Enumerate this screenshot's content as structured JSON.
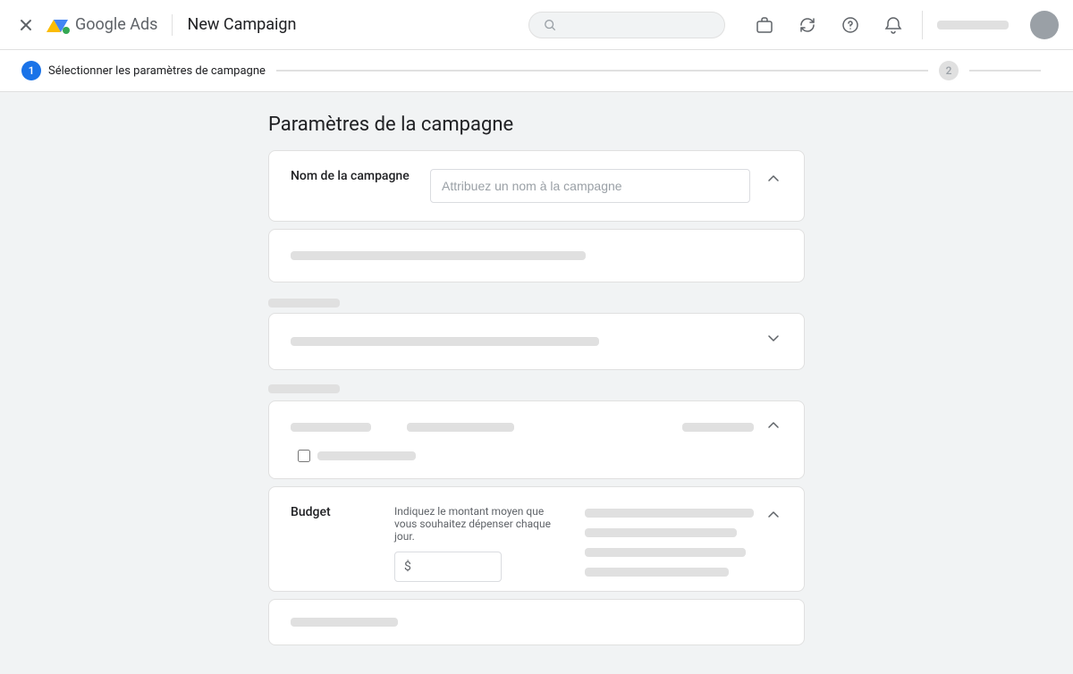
{
  "header": {
    "close_label": "×",
    "app_name": "Google Ads",
    "page_title": "New Campaign",
    "search_placeholder": "",
    "icons": {
      "briefcase": "🗂",
      "refresh": "↻",
      "help": "?",
      "bell": "🔔"
    },
    "account_line": ""
  },
  "stepper": {
    "step1_number": "1",
    "step1_label": "Sélectionner les paramètres de campagne",
    "step2_number": "2",
    "step2_label": ""
  },
  "main": {
    "section_title": "Paramètres de la campagne",
    "campaign_name_card": {
      "label": "Nom de la campagne",
      "input_placeholder": "Attribuez un nom à la campagne"
    },
    "budget_card": {
      "label": "Budget",
      "description": "Indiquez le montant moyen que vous souhaitez dépenser chaque jour.",
      "currency_symbol": "$",
      "input_placeholder": ""
    }
  },
  "skeleton": {
    "line1_width": "60%",
    "line2_width": "40%",
    "line3_width": "55%",
    "line4_width": "70%"
  }
}
